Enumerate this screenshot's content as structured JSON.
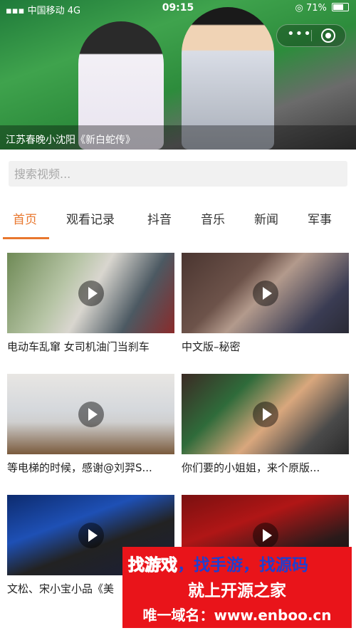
{
  "status_bar": {
    "carrier": "中国移动",
    "network": "4G",
    "time": "09:15",
    "battery": "71%"
  },
  "capsule": {
    "more": "•••"
  },
  "hero": {
    "title": "江苏春晚小沈阳《新白蛇传》"
  },
  "search": {
    "placeholder": "搜索视频..."
  },
  "tabs": [
    {
      "label": "首页",
      "active": true
    },
    {
      "label": "观看记录"
    },
    {
      "label": "抖音"
    },
    {
      "label": "音乐"
    },
    {
      "label": "新闻"
    },
    {
      "label": "军事"
    }
  ],
  "videos": [
    {
      "title": "电动车乱窜 女司机油门当刹车"
    },
    {
      "title": "中文版–秘密"
    },
    {
      "title": "等电梯的时候，感谢@刘羿S..."
    },
    {
      "title": "你们要的小姐姐，来个原版..."
    },
    {
      "title": "文松、宋小宝小品《美"
    },
    {
      "title": ""
    }
  ],
  "watermark": {
    "line1_a": "找游戏",
    "line1_b": "，找手游，找源码",
    "line2": "就上开源之家",
    "line3": "唯一域名：www.enboo.cn"
  },
  "colors": {
    "accent": "#e8772e",
    "banner_red": "#e9141a"
  }
}
